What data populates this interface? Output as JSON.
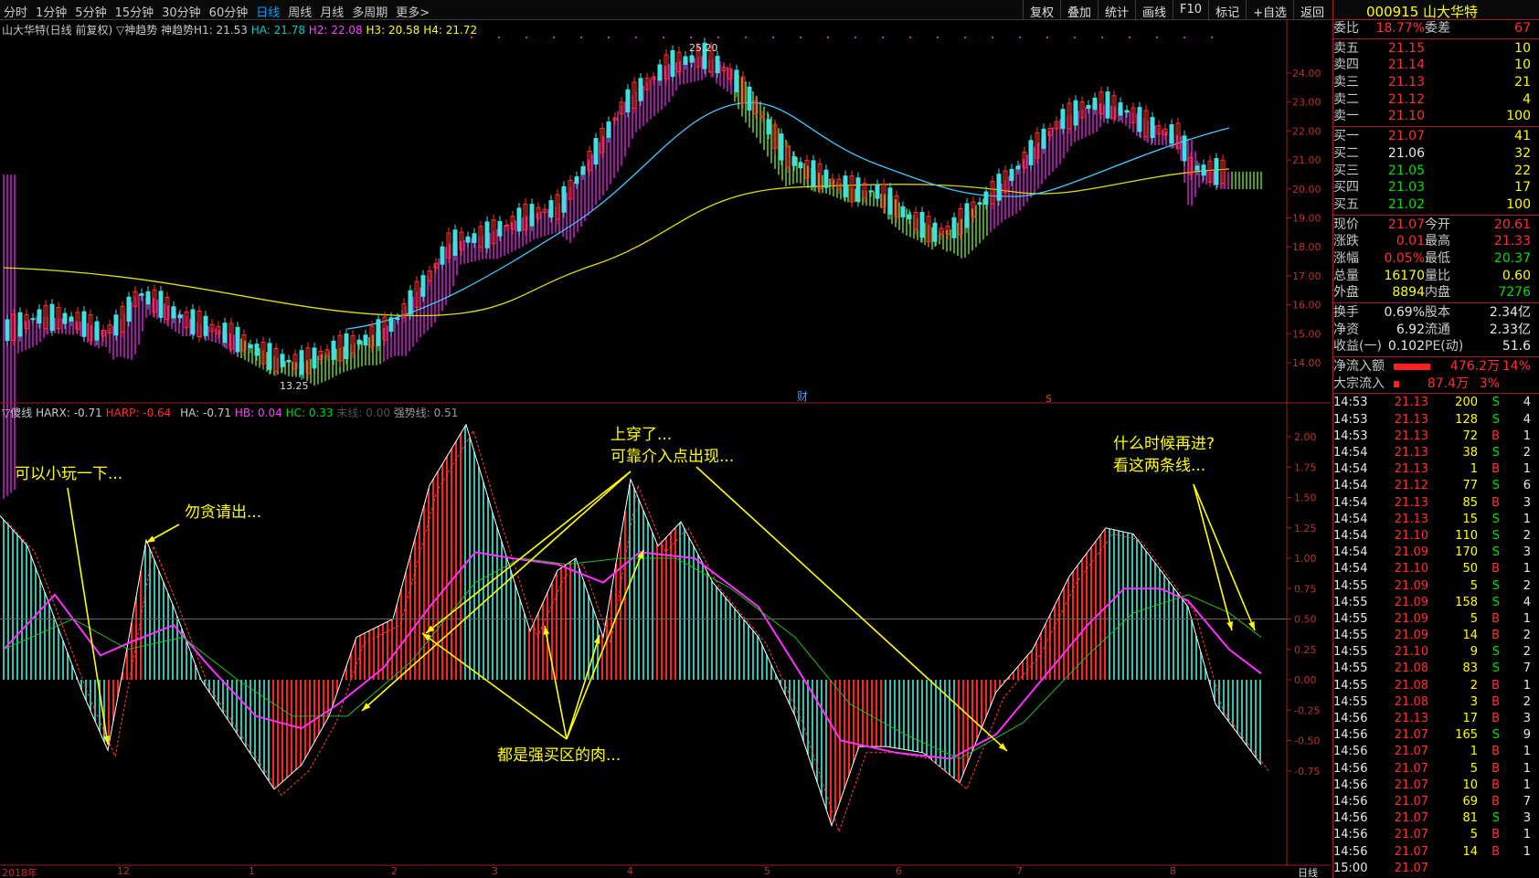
{
  "toolbar": {
    "periods": [
      "分时",
      "1分钟",
      "5分钟",
      "15分钟",
      "30分钟",
      "60分钟",
      "日线",
      "周线",
      "月线",
      "多周期",
      "更多>"
    ],
    "active_period": "日线",
    "tools": [
      "复权",
      "叠加",
      "统计",
      "画线",
      "F10",
      "标记",
      "+自选",
      "返回"
    ]
  },
  "main_chart": {
    "title": "山大华特(日线 前复权) ▽神趋势 神趋势H1: 21.53",
    "ha": "HA: 21.78",
    "h2": "H2: 22.08",
    "h3": "H3: 20.58",
    "h4": "H4: 21.72",
    "high_label": "25.20",
    "low_label": "13.25",
    "marker_cai": "财",
    "marker_s": "S",
    "y_ticks": [
      "24.00",
      "23.00",
      "22.00",
      "21.00",
      "20.00",
      "19.00",
      "18.00",
      "17.00",
      "16.00",
      "15.00",
      "14.00"
    ]
  },
  "sub_chart": {
    "title": "▽傻线",
    "harx": "HARX: -0.71",
    "harp": "HARP: -0.64",
    "ha": "HA: -0.71",
    "hb": "HB: 0.04",
    "hc": "HC: 0.33",
    "hd": "末线: 0.00",
    "he": "强势线: 0.51",
    "y_ticks": [
      "2.00",
      "1.75",
      "1.50",
      "1.25",
      "1.00",
      "0.75",
      "0.50",
      "0.25",
      "0.00",
      "-0.25",
      "-0.50",
      "-0.75"
    ]
  },
  "annotations": {
    "a1": "可以小玩一下...",
    "a2": "勿贪请出...",
    "a3_1": "上穿了...",
    "a3_2": "可靠介入点出现...",
    "a4": "都是强买区的肉...",
    "a5_1": "什么时候再进?",
    "a5_2": "看这两条线..."
  },
  "x_axis": {
    "labels": [
      "2018年",
      "12",
      "1",
      "2",
      "3",
      "4",
      "5",
      "6",
      "7",
      "8"
    ],
    "period_label": "日线"
  },
  "quote": {
    "code": "000915",
    "name": "山大华特",
    "weibi_label": "委比",
    "weibi": "18.77%",
    "weicha_label": "委差",
    "weicha": "67",
    "asks": [
      {
        "l": "卖五",
        "p": "21.15",
        "v": "10"
      },
      {
        "l": "卖四",
        "p": "21.14",
        "v": "10"
      },
      {
        "l": "卖三",
        "p": "21.13",
        "v": "21"
      },
      {
        "l": "卖二",
        "p": "21.12",
        "v": "4"
      },
      {
        "l": "卖一",
        "p": "21.10",
        "v": "100"
      }
    ],
    "bids": [
      {
        "l": "买一",
        "p": "21.07",
        "v": "41"
      },
      {
        "l": "买二",
        "p": "21.06",
        "v": "32"
      },
      {
        "l": "买三",
        "p": "21.05",
        "v": "22"
      },
      {
        "l": "买四",
        "p": "21.03",
        "v": "17"
      },
      {
        "l": "买五",
        "p": "21.02",
        "v": "100"
      }
    ],
    "stats": [
      [
        "现价",
        "21.07",
        "今开",
        "20.61"
      ],
      [
        "涨跌",
        "0.01",
        "最高",
        "21.33"
      ],
      [
        "涨幅",
        "0.05%",
        "最低",
        "20.37"
      ],
      [
        "总量",
        "16170",
        "量比",
        "0.60"
      ],
      [
        "外盘",
        "8894",
        "内盘",
        "7276"
      ]
    ],
    "stats2": [
      [
        "换手",
        "0.69%",
        "股本",
        "2.34亿"
      ],
      [
        "净资",
        "6.92",
        "流通",
        "2.33亿"
      ],
      [
        "收益(一)",
        "0.102",
        "PE(动)",
        "51.6"
      ]
    ],
    "flow": [
      [
        "净流入额",
        "476.2万",
        "14%"
      ],
      [
        "大宗流入",
        "87.4万",
        "3%"
      ]
    ],
    "ticks": [
      [
        "14:53",
        "21.13",
        "200",
        "S",
        "4"
      ],
      [
        "14:53",
        "21.13",
        "128",
        "S",
        "4"
      ],
      [
        "14:53",
        "21.13",
        "72",
        "B",
        "1"
      ],
      [
        "14:54",
        "21.13",
        "38",
        "S",
        "2"
      ],
      [
        "14:54",
        "21.13",
        "1",
        "B",
        "1"
      ],
      [
        "14:54",
        "21.12",
        "77",
        "S",
        "6"
      ],
      [
        "14:54",
        "21.13",
        "85",
        "B",
        "3"
      ],
      [
        "14:54",
        "21.13",
        "15",
        "S",
        "1"
      ],
      [
        "14:54",
        "21.10",
        "110",
        "S",
        "2"
      ],
      [
        "14:54",
        "21.09",
        "170",
        "S",
        "3"
      ],
      [
        "14:54",
        "21.10",
        "50",
        "B",
        "1"
      ],
      [
        "14:55",
        "21.09",
        "5",
        "S",
        "2"
      ],
      [
        "14:55",
        "21.09",
        "158",
        "S",
        "4"
      ],
      [
        "14:55",
        "21.09",
        "5",
        "B",
        "1"
      ],
      [
        "14:55",
        "21.09",
        "14",
        "B",
        "2"
      ],
      [
        "14:55",
        "21.10",
        "9",
        "S",
        "2"
      ],
      [
        "14:55",
        "21.08",
        "83",
        "S",
        "7"
      ],
      [
        "14:55",
        "21.08",
        "2",
        "B",
        "1"
      ],
      [
        "14:55",
        "21.08",
        "3",
        "B",
        "2"
      ],
      [
        "14:56",
        "21.13",
        "17",
        "B",
        "3"
      ],
      [
        "14:56",
        "21.07",
        "165",
        "S",
        "9"
      ],
      [
        "14:56",
        "21.07",
        "1",
        "B",
        "1"
      ],
      [
        "14:56",
        "21.07",
        "5",
        "B",
        "1"
      ],
      [
        "14:56",
        "21.07",
        "10",
        "B",
        "1"
      ],
      [
        "14:56",
        "21.07",
        "69",
        "B",
        "7"
      ],
      [
        "14:56",
        "21.07",
        "81",
        "S",
        "3"
      ],
      [
        "14:56",
        "21.07",
        "5",
        "B",
        "1"
      ],
      [
        "14:56",
        "21.07",
        "14",
        "B",
        "1"
      ],
      [
        "15:00",
        "21.07",
        "",
        "",
        ""
      ]
    ]
  }
}
